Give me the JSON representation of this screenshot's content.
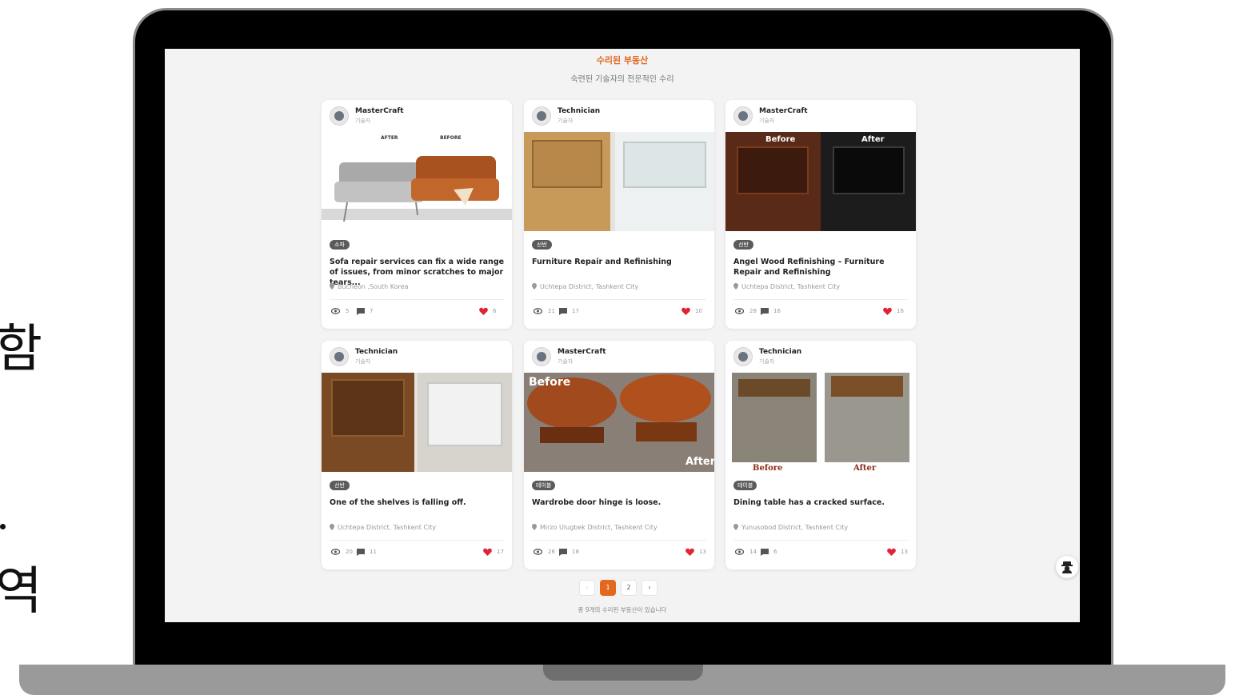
{
  "side_text": {
    "top_char": "함",
    "bottom_char": "역"
  },
  "header": {
    "title": "수리된 부동산",
    "subtitle": "숙련된 기술자의 전문적인 수리"
  },
  "cards": [
    {
      "author": "MasterCraft",
      "role": "기술자",
      "before_label": "AFTER",
      "after_label": "BEFORE",
      "category": "소파",
      "title": "Sofa repair services can fix a wide range of issues, from minor scratches to major tears...",
      "location": "Bucheon ,South Korea",
      "views": "5",
      "comments": "7",
      "likes": "6"
    },
    {
      "author": "Technician",
      "role": "기술자",
      "before_label": "",
      "after_label": "",
      "category": "선반",
      "title": "Furniture Repair and Refinishing",
      "location": "Uchtepa District, Tashkent City",
      "views": "21",
      "comments": "17",
      "likes": "10"
    },
    {
      "author": "MasterCraft",
      "role": "기술자",
      "before_label": "Before",
      "after_label": "After",
      "category": "선반",
      "title": "Angel Wood Refinishing – Furniture Repair and Refinishing",
      "location": "Uchtepa District, Tashkent City",
      "views": "28",
      "comments": "16",
      "likes": "16"
    },
    {
      "author": "Technician",
      "role": "기술자",
      "before_label": "",
      "after_label": "",
      "category": "선반",
      "title": "One of the shelves is falling off.",
      "location": "Uchtepa District, Tashkent City",
      "views": "20",
      "comments": "11",
      "likes": "17"
    },
    {
      "author": "MasterCraft",
      "role": "기술자",
      "before_label": "Before",
      "after_label": "After",
      "category": "테이블",
      "title": "Wardrobe door hinge is loose.",
      "location": "Mirzo Ulugbek District, Tashkent City",
      "views": "26",
      "comments": "18",
      "likes": "13"
    },
    {
      "author": "Technician",
      "role": "기술자",
      "before_label": "Before",
      "after_label": "After",
      "category": "테이블",
      "title": "Dining table has a cracked surface.",
      "location": "Yunusobod District, Tashkent City",
      "views": "14",
      "comments": "6",
      "likes": "13"
    }
  ],
  "pagination": {
    "prev": "‹",
    "pages": [
      "1",
      "2"
    ],
    "next": "›",
    "current": "1"
  },
  "footer_note": "총 9개의 수리된 부동산이 있습니다",
  "colors": {
    "accent": "#e2681f",
    "like": "#e02435",
    "badge": "#5b5b5b"
  },
  "icons": {
    "views": "eye-icon",
    "comments": "comment-icon",
    "likes": "heart-icon",
    "location": "pin-icon",
    "fab": "user-hat-icon"
  }
}
